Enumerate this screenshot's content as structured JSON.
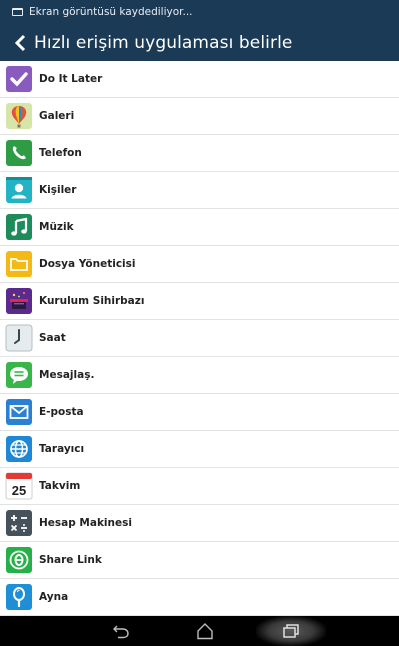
{
  "status_bar": {
    "text": "Ekran görüntüsü kaydediliyor..."
  },
  "header": {
    "title": "Hızlı erişim uygulaması belirle"
  },
  "apps": [
    {
      "label": "Do It Later",
      "icon": "check-icon",
      "color": "#8a5bbf"
    },
    {
      "label": "Galeri",
      "icon": "balloon-icon",
      "color": "#d6e6a8"
    },
    {
      "label": "Telefon",
      "icon": "phone-icon",
      "color": "#2e9c45"
    },
    {
      "label": "Kişiler",
      "icon": "contacts-icon",
      "color": "#22b3c5"
    },
    {
      "label": "Müzik",
      "icon": "music-icon",
      "color": "#1d8c5a"
    },
    {
      "label": "Dosya Yöneticisi",
      "icon": "folder-icon",
      "color": "#f5b914"
    },
    {
      "label": "Kurulum Sihirbazı",
      "icon": "wizard-icon",
      "color": "#5a2a8c"
    },
    {
      "label": "Saat",
      "icon": "clock-icon",
      "color": "#cfd8dc"
    },
    {
      "label": "Mesajlaş.",
      "icon": "message-icon",
      "color": "#3ab54a"
    },
    {
      "label": "E-posta",
      "icon": "mail-icon",
      "color": "#2a80d2"
    },
    {
      "label": "Tarayıcı",
      "icon": "globe-icon",
      "color": "#1e88d6"
    },
    {
      "label": "Takvim",
      "icon": "calendar-icon",
      "color": "#e53935",
      "day": "25"
    },
    {
      "label": "Hesap Makinesi",
      "icon": "calculator-icon",
      "color": "#45515b"
    },
    {
      "label": "Share Link",
      "icon": "share-link-icon",
      "color": "#27b04a"
    },
    {
      "label": "Ayna",
      "icon": "mirror-icon",
      "color": "#1e8fd6"
    }
  ],
  "nav": {
    "back": "back-icon",
    "home": "home-icon",
    "recents": "recents-icon"
  }
}
